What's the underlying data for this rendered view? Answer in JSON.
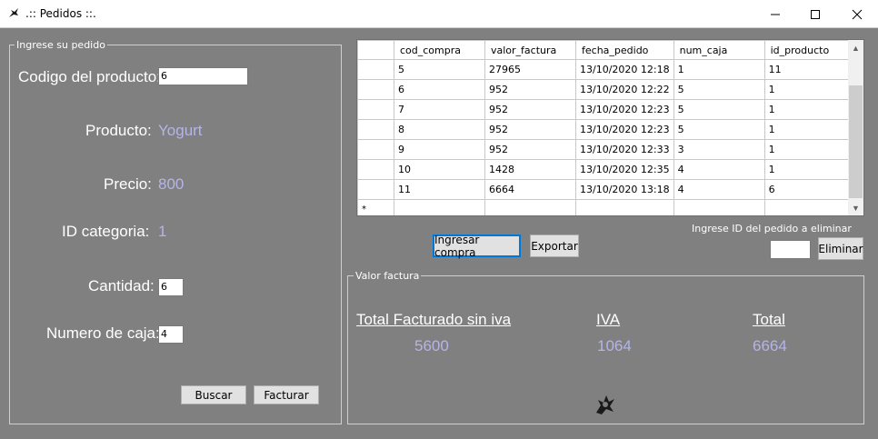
{
  "window": {
    "title": ".:: Pedidos ::.",
    "minimize_icon": "minimize-icon",
    "maximize_icon": "maximize-icon",
    "close_icon": "close-icon"
  },
  "pedido_group": {
    "label": "Ingrese su pedido",
    "codigo_label": "Codigo del producto:",
    "codigo_value": "6",
    "producto_label": "Producto:",
    "producto_value": "Yogurt",
    "precio_label": "Precio:",
    "precio_value": "800",
    "categoria_label": "ID categoria:",
    "categoria_value": "1",
    "cantidad_label": "Cantidad:",
    "cantidad_value": "6",
    "caja_label": "Numero de caja:",
    "caja_value": "4",
    "buscar_label": "Buscar",
    "facturar_label": "Facturar"
  },
  "grid": {
    "columns": [
      "cod_compra",
      "valor_factura",
      "fecha_pedido",
      "num_caja",
      "id_producto"
    ],
    "rows": [
      [
        "5",
        "27965",
        "13/10/2020 12:18",
        "1",
        "11"
      ],
      [
        "6",
        "952",
        "13/10/2020 12:22",
        "5",
        "1"
      ],
      [
        "7",
        "952",
        "13/10/2020 12:23",
        "5",
        "1"
      ],
      [
        "8",
        "952",
        "13/10/2020 12:23",
        "5",
        "1"
      ],
      [
        "9",
        "952",
        "13/10/2020 12:33",
        "3",
        "1"
      ],
      [
        "10",
        "1428",
        "13/10/2020 12:35",
        "4",
        "1"
      ],
      [
        "11",
        "6664",
        "13/10/2020 13:18",
        "4",
        "6"
      ]
    ],
    "new_row_marker": "*"
  },
  "actions": {
    "ingresar_label": "Ingresar compra",
    "exportar_label": "Exportar",
    "eliminar_prompt": "Ingrese ID del pedido a eliminar",
    "eliminar_value": "",
    "eliminar_label": "Eliminar"
  },
  "factura_group": {
    "label": "Valor factura",
    "sin_iva_label": "Total Facturado sin iva",
    "sin_iva_value": "5600",
    "iva_label": "IVA",
    "iva_value": "1064",
    "total_label": "Total",
    "total_value": "6664"
  }
}
